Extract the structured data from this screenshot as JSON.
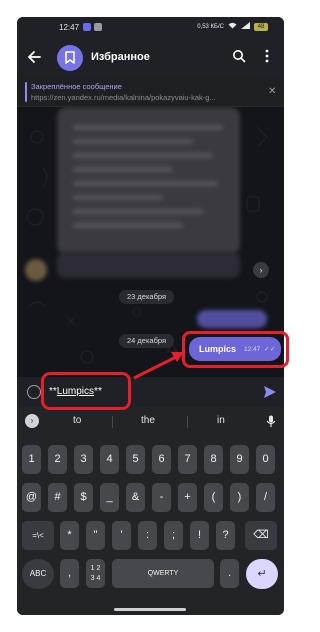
{
  "status": {
    "time": "12:47",
    "signal": "0,53 КБ/С",
    "battery": "48",
    "app_dot_colors": [
      "#6b6af0",
      "#9a9aa0"
    ]
  },
  "header": {
    "title": "Избранное",
    "avatar_color": "#7873e6"
  },
  "pinned": {
    "title": "Закреплённое сообщение",
    "link": "https://zen.yandex.ru/media/kalnina/pokazyvaiu-kak-g..."
  },
  "chat": {
    "dates": [
      "23 декабря",
      "24 декабря"
    ],
    "message": {
      "text": "Lumpics",
      "time": "12:47",
      "ticks": "✓✓"
    }
  },
  "input": {
    "prefix": "**",
    "word": "Lumpics",
    "suffix": "**"
  },
  "keyboard": {
    "suggestions": [
      "to",
      "the",
      "in"
    ],
    "row1": [
      "1",
      "2",
      "3",
      "4",
      "5",
      "6",
      "7",
      "8",
      "9",
      "0"
    ],
    "row2": [
      "@",
      "#",
      "$",
      "_",
      "&",
      "-",
      "+",
      "(",
      ")",
      "/"
    ],
    "row3": [
      "=\\<",
      "*",
      "\"",
      "'",
      ":",
      ";",
      "!",
      "?",
      "⌫"
    ],
    "row4": {
      "abc": "ABC",
      "comma": ",",
      "numpad": "1 2\n3 4",
      "space": "QWERTY",
      "dot": ".",
      "enter": "↵"
    }
  },
  "colors": {
    "accent": "#6c66d8",
    "highlight": "#e5202a"
  }
}
